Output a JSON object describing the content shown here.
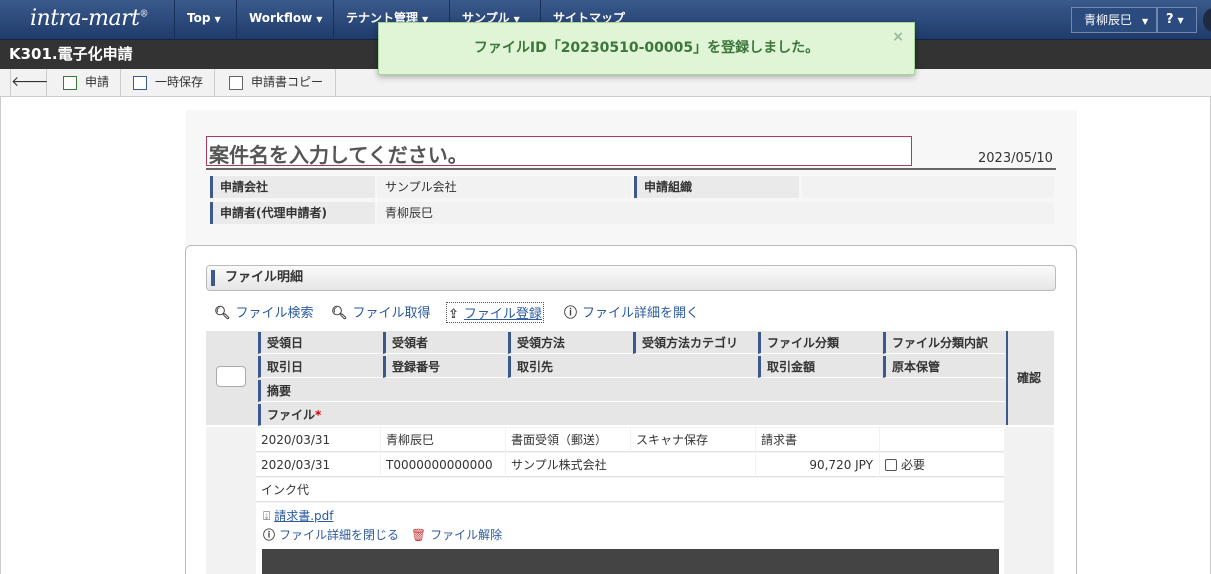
{
  "nav": {
    "logo": "intra-mart",
    "items": [
      {
        "label": "Top"
      },
      {
        "label": "Workflow"
      },
      {
        "label": "テナント管理"
      },
      {
        "label": "サンプル"
      },
      {
        "label": "サイトマップ"
      }
    ],
    "user": "青柳辰巳",
    "help": "?"
  },
  "page_title": "K301.電子化申請",
  "toolbar": {
    "apply": "申請",
    "save": "一時保存",
    "copy": "申請書コピー"
  },
  "toast": {
    "message": "ファイルID「20230510-00005」を登録しました。",
    "close": "×"
  },
  "form": {
    "case_placeholder": "案件名を入力してください。",
    "date": "2023/05/10",
    "company_label": "申請会社",
    "company_value": "サンプル会社",
    "org_label": "申請組織",
    "org_value": "",
    "applicant_label": "申請者(代理申請者)",
    "applicant_value": "青柳辰巳"
  },
  "file_section": {
    "title": "ファイル明細",
    "actions": {
      "search": "ファイル検索",
      "fetch": "ファイル取得",
      "register": "ファイル登録",
      "detail": "ファイル詳細を開く"
    },
    "headers": {
      "receive_date": "受領日",
      "receiver": "受領者",
      "receive_method": "受領方法",
      "receive_category": "受領方法カテゴリ",
      "file_class": "ファイル分類",
      "file_class_detail": "ファイル分類内訳",
      "deal_date": "取引日",
      "reg_no": "登録番号",
      "partner": "取引先",
      "amount": "取引金額",
      "original": "原本保管",
      "summary": "摘要",
      "file": "ファイル",
      "required_mark": "*",
      "confirm": "確認"
    },
    "row": {
      "receive_date": "2020/03/31",
      "receiver": "青柳辰巳",
      "receive_method": "書面受領（郵送）",
      "receive_category": "スキャナ保存",
      "file_class": "請求書",
      "file_class_detail": "",
      "deal_date": "2020/03/31",
      "reg_no": "T0000000000000",
      "partner": "サンプル株式会社",
      "amount": "90,720 JPY",
      "original_label": "必要",
      "summary": "インク代",
      "file_name": "請求書.pdf",
      "close_detail": "ファイル詳細を閉じる",
      "release": "ファイル解除"
    }
  }
}
